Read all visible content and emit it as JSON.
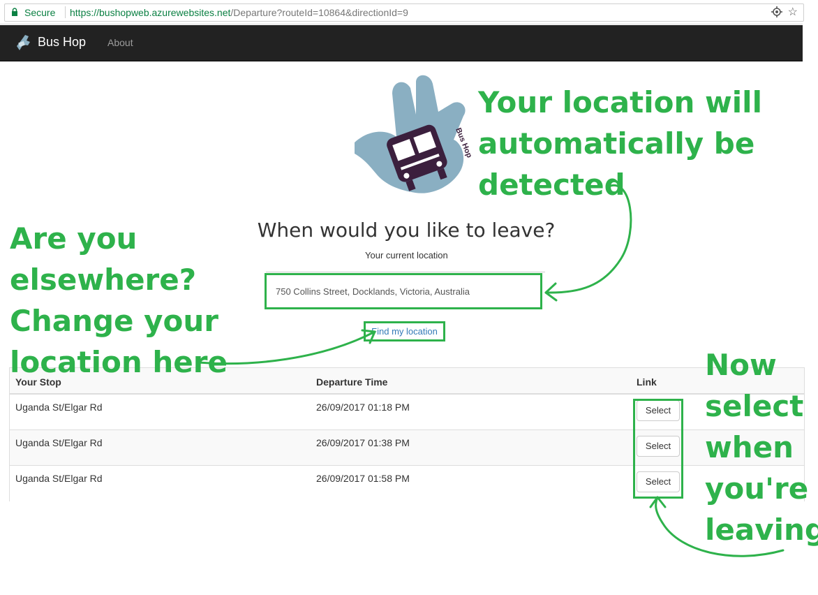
{
  "browser": {
    "secure_label": "Secure",
    "url_host": "https://bushopweb.azurewebsites.net",
    "url_path": "/Departure?routeId=10864&directionId=9"
  },
  "navbar": {
    "brand": "Bus Hop",
    "items": [
      {
        "label": "About"
      }
    ]
  },
  "logo": {
    "text": "Bus Hop"
  },
  "main": {
    "heading": "When would you like to leave?",
    "location_label": "Your current location",
    "location_value": "750 Collins Street, Docklands, Victoria, Australia",
    "find_button": "Find my location"
  },
  "table": {
    "columns": [
      "Your Stop",
      "Departure Time",
      "Link"
    ],
    "rows": [
      {
        "stop": "Uganda St/Elgar Rd",
        "time": "26/09/2017 01:18 PM",
        "link": "Select"
      },
      {
        "stop": "Uganda St/Elgar Rd",
        "time": "26/09/2017 01:38 PM",
        "link": "Select"
      },
      {
        "stop": "Uganda St/Elgar Rd",
        "time": "26/09/2017 01:58 PM",
        "link": "Select"
      }
    ]
  },
  "annotations": {
    "location_detect": [
      "Your location will",
      "automatically be",
      "detected"
    ],
    "elsewhere": [
      "Are you",
      "elsewhere?",
      "Change your",
      "location here"
    ],
    "select": [
      "Now",
      "select",
      "when",
      "you're",
      "leaving"
    ]
  },
  "colors": {
    "annotation_green": "#2eb24b",
    "navbar": "#222222",
    "logo_blue": "#8aafc2",
    "logo_bus": "#3b1f3d"
  }
}
